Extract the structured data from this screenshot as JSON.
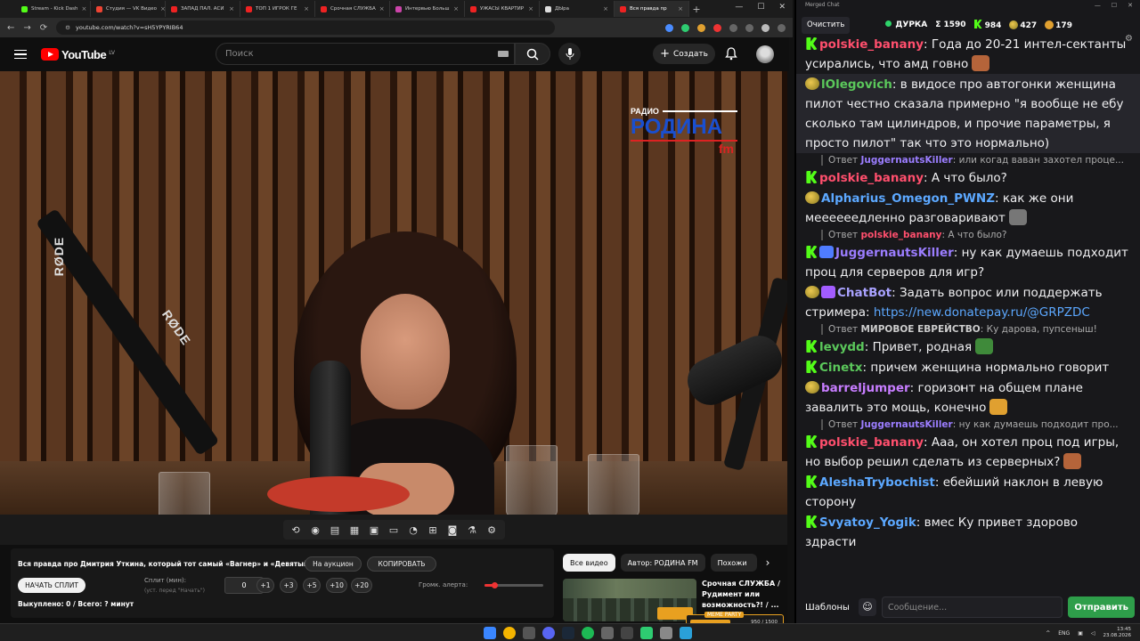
{
  "browser": {
    "tabs": [
      {
        "label": "Stream - Kick Dash",
        "color": "#53fc18",
        "active": false
      },
      {
        "label": "Студия — VK Видео",
        "color": "#e43",
        "active": false
      },
      {
        "label": "ЗАПАД ПАЛ. АСИ",
        "color": "#e22",
        "active": false
      },
      {
        "label": "ТОП 1 ИГРОК ГЕ",
        "color": "#e22",
        "active": false
      },
      {
        "label": "Срочная СЛУЖБА",
        "color": "#e22",
        "active": false
      },
      {
        "label": "Интервью Больш",
        "color": "#c4a",
        "active": false
      },
      {
        "label": "УЖАСЫ КВАРТИР",
        "color": "#e22",
        "active": false
      },
      {
        "label": "ДЫра",
        "color": "#ddd",
        "active": false
      },
      {
        "label": "Вся правда пр",
        "color": "#e22",
        "active": true
      }
    ],
    "url": "youtube.com/watch?v=sH5YPYRIB64"
  },
  "youtube": {
    "logo_text": "YouTube",
    "logo_country": "LV",
    "search_placeholder": "Поиск",
    "create_label": "Создать"
  },
  "video": {
    "brand_line1": "РАДИО",
    "brand_line2": "РОДИНА",
    "brand_line3": "fm",
    "mic_brand": "RØDE"
  },
  "controls": {
    "title": "Вся правда про Дмитрия Уткина, который тот самый «Вагнер» и «Девятый»!",
    "auction_label": "На аукцион",
    "copy_label": "КОПИРОВАТЬ",
    "start_split_label": "НАЧАТЬ СПЛИТ",
    "split_label": "Сплит (мин):",
    "split_hint": "(уст. перед \"Начать\")",
    "split_value": "0",
    "increments": [
      "+1",
      "+3",
      "+5",
      "+10",
      "+20"
    ],
    "alert_volume_label": "Громк. алерта:",
    "alert_volume_level": 0.17,
    "bought_text": "Выкуплено: 0 / Всего: ? минут"
  },
  "related": {
    "chips": [
      "Все видео",
      "Автор: РОДИНА FM",
      "Похожи"
    ],
    "video_title": "Срочная СЛУЖБА / Рудимент или возможность?! / ..."
  },
  "meme_party": {
    "label": "MEME PARTY",
    "value": "950 / 1500",
    "progress": 0.63
  },
  "system": {
    "lang": "ENG",
    "time": "13:45",
    "date": "23.08.2026"
  },
  "chat": {
    "window_title": "Merged Chat",
    "clear_label": "Очистить",
    "channel": "ДУРКА",
    "total": "Σ 1590",
    "kick_count": "984",
    "other_count": "427",
    "third_count": "179",
    "templates_label": "Шаблоны",
    "input_placeholder": "Сообщение...",
    "send_label": "Отправить",
    "messages": [
      {
        "type": "msg",
        "badges": [
          "k"
        ],
        "user": "polskie_banany",
        "color": "#ff4f6d",
        "text": "Года до 20-21 интел-сектанты усирались, что амд говно",
        "emote": "#b5643a"
      },
      {
        "type": "msg",
        "badges": [
          "blob"
        ],
        "user": "lOlegovich",
        "color": "#5bc85b",
        "text": "в видосе про автогонки женщина пилот честно сказала примерно \"я вообще не ебу сколько там цилиндров, и прочие параметры, я просто пилот\" так что это нормально)",
        "highlight": true
      },
      {
        "type": "reply",
        "user": "JuggernautsKiller",
        "color": "#9b7dff",
        "text": "или когад ваван захотел проце..."
      },
      {
        "type": "msg",
        "badges": [
          "k"
        ],
        "user": "polskie_banany",
        "color": "#ff4f6d",
        "text": "А что было?"
      },
      {
        "type": "msg",
        "badges": [
          "blob"
        ],
        "user": "Alpharius_Omegon_PWNZ",
        "color": "#5ca8ff",
        "text": "как же они меееееедленно разговаривают",
        "emote": "#777"
      },
      {
        "type": "reply",
        "user": "polskie_banany",
        "color": "#ff4f6d",
        "text": "А что было?"
      },
      {
        "type": "msg",
        "badges": [
          "k",
          "tw"
        ],
        "user": "JuggernautsKiller",
        "color": "#9b7dff",
        "text": "ну как думаешь подходит проц для серверов для игр?"
      },
      {
        "type": "msg",
        "badges": [
          "blob",
          "pu"
        ],
        "user": "ChatBot",
        "color": "#a9a2ff",
        "text": "Задать вопрос или поддержать стримера: ",
        "link": "https://new.donatepay.ru/@GRPZDC"
      },
      {
        "type": "reply",
        "user": "МИРОВОЕ ЕВРЕЙСТВО",
        "color": "#ccc",
        "text": "Ку дарова, пупсеныш!"
      },
      {
        "type": "msg",
        "badges": [
          "k"
        ],
        "user": "levydd",
        "color": "#5bc85b",
        "text": "Привет, родная",
        "emote": "#3f8a3a"
      },
      {
        "type": "msg",
        "badges": [
          "k"
        ],
        "user": "Cinetx",
        "color": "#5bc85b",
        "text": "причем женщина нормально говорит"
      },
      {
        "type": "msg",
        "badges": [
          "blob"
        ],
        "user": "barreljumper",
        "color": "#c77dff",
        "text": "горизонт на общем плане завалить это мощь, конечно",
        "emote": "#e0a030"
      },
      {
        "type": "reply",
        "user": "JuggernautsKiller",
        "color": "#9b7dff",
        "text": "ну как думаешь подходит про..."
      },
      {
        "type": "msg",
        "badges": [
          "k"
        ],
        "user": "polskie_banany",
        "color": "#ff4f6d",
        "text": "Ааа, он хотел проц под игры, но выбор решил сделать из серверных?",
        "emote": "#b5643a"
      },
      {
        "type": "msg",
        "badges": [
          "k"
        ],
        "user": "AleshaTrybochist",
        "color": "#5ca8ff",
        "text": "ебейший наклон в левую сторону"
      },
      {
        "type": "msg",
        "badges": [
          "k"
        ],
        "user": "Svyatoy_Yogik",
        "color": "#5ca8ff",
        "text": "вмес Ку привет здорово здрасти"
      }
    ]
  }
}
